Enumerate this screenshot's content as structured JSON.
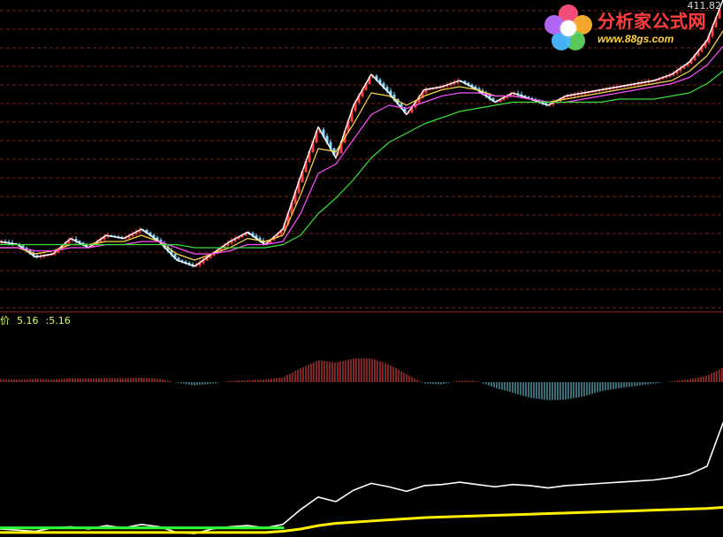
{
  "header": {
    "logo_cn": "分析家公式网",
    "logo_url": "www.88gs.com",
    "corner_value": "411.82"
  },
  "indicator": {
    "name": "价",
    "value1": "5.16",
    "value2": ":5.16"
  },
  "colors": {
    "background": "#000000",
    "grid": "#7a1f1f",
    "main_up": "#ff3c3c",
    "main_down": "#7ed7ff",
    "ma_white": "#ffffff",
    "ma_yellow": "#ffd84a",
    "ma_magenta": "#ff4fff",
    "ma_green": "#38e038",
    "indicator_white": "#ffffff",
    "indicator_yellow": "#ffee00",
    "indicator_green": "#32ff32",
    "hist_red": "#ff4a4a",
    "hist_cyan": "#6fd8e8",
    "label_green": "#d7ff5a"
  },
  "chart_data": [
    {
      "type": "line",
      "x": [
        0,
        20,
        40,
        60,
        80,
        100,
        120,
        140,
        160,
        180,
        200,
        220,
        240,
        260,
        280,
        300,
        320,
        340,
        360,
        380,
        400,
        420,
        440,
        460,
        480,
        500,
        520,
        540,
        560,
        580,
        600,
        620,
        640,
        660,
        680,
        700,
        720,
        740,
        760,
        780,
        800,
        818
      ],
      "xlim": [
        0,
        818
      ],
      "ylim": [
        0,
        100
      ],
      "grid": true,
      "series": [
        {
          "values": [
            22,
            21,
            17,
            18,
            23,
            20,
            24,
            23,
            26,
            22,
            16,
            14,
            18,
            22,
            25,
            21,
            26,
            43,
            59,
            49,
            66,
            76,
            70,
            63,
            71,
            72,
            74,
            71,
            67,
            70,
            68,
            66,
            69,
            70,
            71,
            72,
            73,
            74,
            76,
            80,
            87,
            100
          ],
          "color": "#ffffff"
        },
        {
          "values": [
            20,
            20,
            18,
            19,
            21,
            21,
            22,
            22,
            24,
            22,
            18,
            16,
            18,
            20,
            23,
            22,
            24,
            37,
            52,
            51,
            60,
            70,
            69,
            66,
            69,
            71,
            72,
            71,
            69,
            69,
            68,
            67,
            68,
            69,
            70,
            71,
            72,
            73,
            74,
            77,
            82,
            90
          ],
          "color": "#ffd84a"
        },
        {
          "values": [
            20,
            20,
            19,
            19,
            20,
            20,
            21,
            21,
            22,
            22,
            20,
            18,
            18,
            19,
            21,
            21,
            22,
            31,
            44,
            47,
            55,
            63,
            66,
            65,
            67,
            69,
            70,
            70,
            69,
            69,
            68,
            67,
            67,
            68,
            69,
            70,
            71,
            72,
            73,
            75,
            79,
            85
          ],
          "color": "#ff4fff"
        },
        {
          "values": [
            21,
            21,
            21,
            21,
            21,
            21,
            21,
            21,
            21,
            21,
            21,
            20,
            20,
            20,
            20,
            20,
            21,
            24,
            31,
            36,
            42,
            49,
            54,
            57,
            60,
            62,
            64,
            65,
            66,
            67,
            67,
            67,
            67,
            67,
            67,
            68,
            68,
            68,
            69,
            70,
            73,
            77
          ],
          "color": "#38e038"
        }
      ]
    },
    {
      "type": "bar",
      "x": [
        0,
        20,
        40,
        60,
        80,
        100,
        120,
        140,
        160,
        180,
        200,
        220,
        240,
        260,
        280,
        300,
        320,
        340,
        360,
        380,
        400,
        420,
        440,
        460,
        480,
        500,
        520,
        540,
        560,
        580,
        600,
        620,
        640,
        660,
        680,
        700,
        720,
        740,
        760,
        780,
        800,
        818
      ],
      "values": [
        1.2,
        1.0,
        1.3,
        1.0,
        1.5,
        1.4,
        1.6,
        1.5,
        1.7,
        1.3,
        -0.2,
        -1.2,
        -0.5,
        0.4,
        0.8,
        1.0,
        1.8,
        5.2,
        8.3,
        7.4,
        8.9,
        9.0,
        6.7,
        3.0,
        -0.5,
        -0.8,
        0.6,
        0.4,
        -2.1,
        -4.0,
        -5.9,
        -6.8,
        -6.6,
        -5.4,
        -3.4,
        -2.3,
        -1.4,
        -0.5,
        0.3,
        1.1,
        2.5,
        5.5
      ],
      "xlim": [
        0,
        818
      ],
      "ylim": [
        -10,
        10
      ]
    },
    {
      "type": "line",
      "x": [
        0,
        20,
        40,
        60,
        80,
        100,
        120,
        140,
        160,
        180,
        200,
        220,
        240,
        260,
        280,
        300,
        320,
        340,
        360,
        380,
        400,
        420,
        440,
        460,
        480,
        500,
        520,
        540,
        560,
        580,
        600,
        620,
        640,
        660,
        680,
        700,
        720,
        740,
        760,
        780,
        800,
        818
      ],
      "xlim": [
        0,
        818
      ],
      "ylim": [
        0,
        100
      ],
      "series": [
        {
          "values": [
            7,
            6,
            5,
            8,
            9,
            7,
            10,
            8,
            11,
            9,
            4,
            3,
            7,
            9,
            10,
            8,
            11,
            24,
            35,
            31,
            41,
            47,
            44,
            40,
            45,
            46,
            48,
            46,
            44,
            46,
            45,
            43,
            45,
            46,
            47,
            48,
            49,
            50,
            52,
            55,
            62,
            100
          ],
          "color": "#ffffff"
        },
        {
          "values": [
            4,
            4,
            4,
            4,
            4,
            4,
            4,
            4,
            4,
            4,
            4,
            4,
            4,
            4,
            4,
            4,
            5,
            7,
            10,
            12,
            13,
            14,
            15,
            16,
            17,
            17.5,
            18,
            18.5,
            19,
            19.5,
            20,
            20.5,
            21,
            21.5,
            22,
            22.5,
            23,
            23.5,
            24,
            24.5,
            25,
            26
          ],
          "color": "#ffee00"
        },
        {
          "values": [
            8,
            8,
            8,
            8,
            8,
            8,
            8,
            8,
            8,
            8,
            8,
            8,
            8,
            8,
            8,
            8,
            8,
            null,
            null,
            null,
            null,
            null,
            null,
            null,
            null,
            null,
            null,
            null,
            null,
            null,
            null,
            null,
            null,
            null,
            null,
            null,
            null,
            null,
            null,
            null,
            null,
            null
          ],
          "color": "#32ff32"
        }
      ]
    }
  ]
}
